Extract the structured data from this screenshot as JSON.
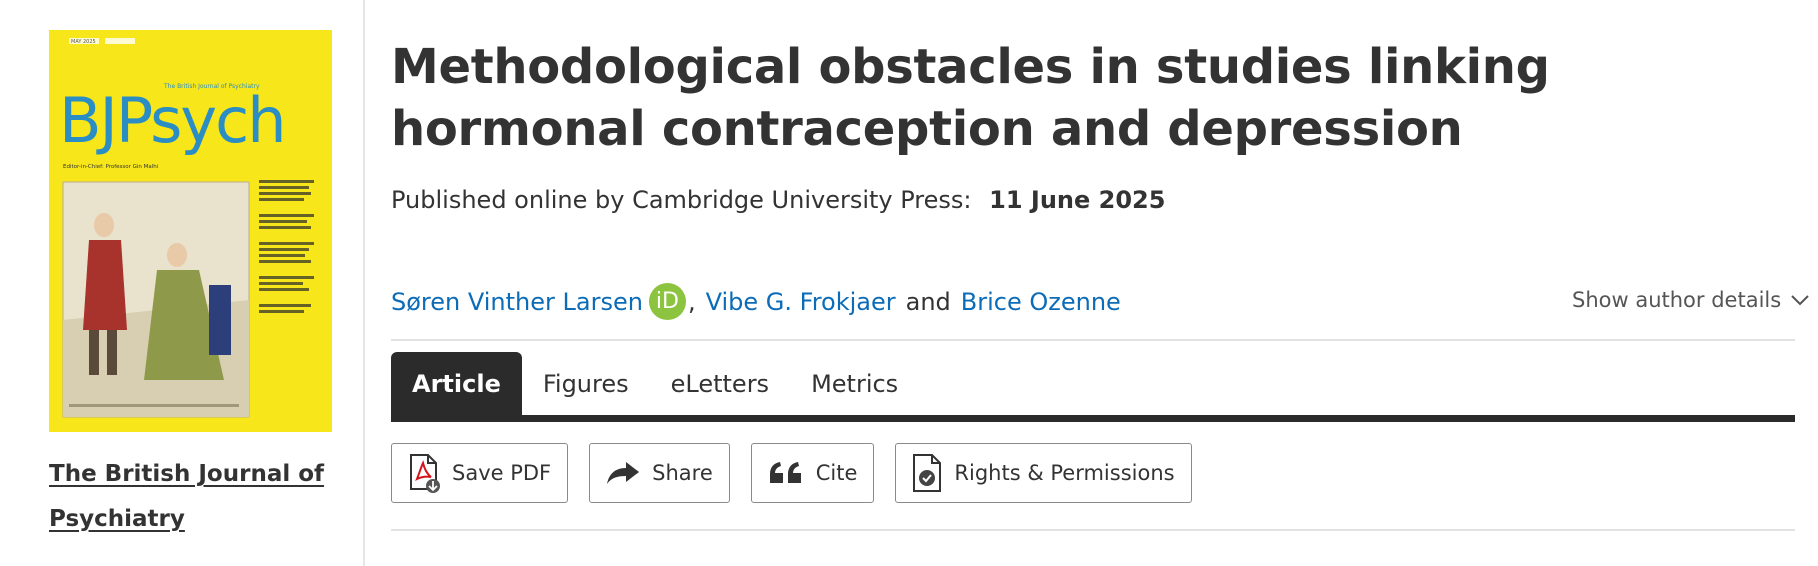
{
  "cover": {
    "logo_text": "BJPsych",
    "journal_small": "The British Journal of Psychiatry",
    "editor_line": "Editor-in-Chief: Professor Gin Malhi",
    "issue_label": "MAY 2025",
    "colors": {
      "background": "#f7e71a",
      "logo": "#2a8dc4"
    }
  },
  "sidebar": {
    "journal_link": "The British Journal of Psychiatry"
  },
  "article": {
    "title": "Methodological obstacles in studies linking hormonal contraception and depression",
    "published_label": "Published online by Cambridge University Press:",
    "published_date": "11 June 2025"
  },
  "authors": {
    "list": [
      {
        "name": "Søren Vinther Larsen",
        "orcid": true
      },
      {
        "name": "Vibe G. Frokjaer"
      },
      {
        "name": "Brice Ozenne"
      }
    ],
    "separator": ",",
    "and_text": "and",
    "orcid_label": "iD",
    "show_details_label": "Show author details",
    "link_color": "#0c6cb7",
    "orcid_color": "#8cc43f"
  },
  "tabs": [
    {
      "label": "Article",
      "active": true
    },
    {
      "label": "Figures",
      "active": false
    },
    {
      "label": "eLetters",
      "active": false
    },
    {
      "label": "Metrics",
      "active": false
    }
  ],
  "actions": [
    {
      "label": "Save PDF",
      "icon": "pdf-download-icon"
    },
    {
      "label": "Share",
      "icon": "share-arrow-icon"
    },
    {
      "label": "Cite",
      "icon": "quote-icon"
    },
    {
      "label": "Rights & Permissions",
      "icon": "document-check-icon"
    }
  ]
}
